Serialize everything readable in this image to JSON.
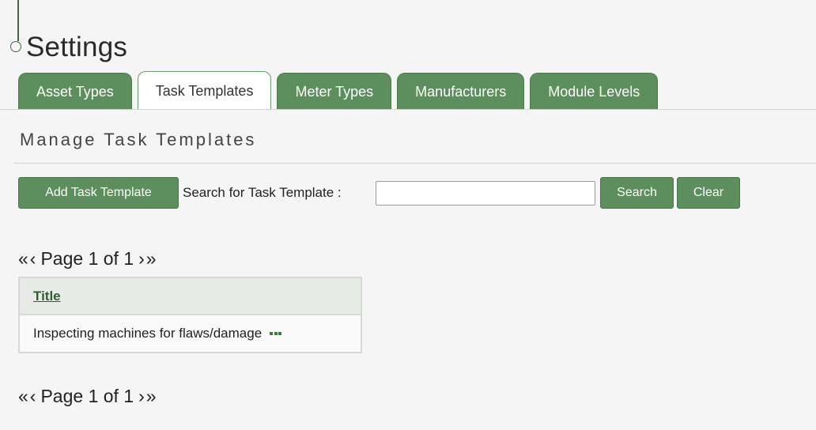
{
  "page": {
    "title": "Settings"
  },
  "tabs": [
    {
      "label": "Asset Types",
      "active": false
    },
    {
      "label": "Task Templates",
      "active": true
    },
    {
      "label": "Meter Types",
      "active": false
    },
    {
      "label": "Manufacturers",
      "active": false
    },
    {
      "label": "Module Levels",
      "active": false
    }
  ],
  "section": {
    "heading": "Manage Task Templates"
  },
  "toolbar": {
    "add_label": "Add Task Template",
    "search_label": "Search for Task Template :",
    "search_value": "",
    "search_button_label": "Search",
    "clear_button_label": "Clear"
  },
  "pager": {
    "first_icon": "«",
    "prev_icon": "‹",
    "text": "Page 1 of 1",
    "next_icon": "›",
    "last_icon": "»"
  },
  "table": {
    "column_header": "Title",
    "rows": [
      {
        "title": "Inspecting machines for flaws/damage",
        "action_icon": "more-icon"
      }
    ]
  },
  "colors": {
    "accent": "#5d8e5d",
    "accent_dark": "#2f5f2f",
    "background": "#f5f5f5"
  }
}
